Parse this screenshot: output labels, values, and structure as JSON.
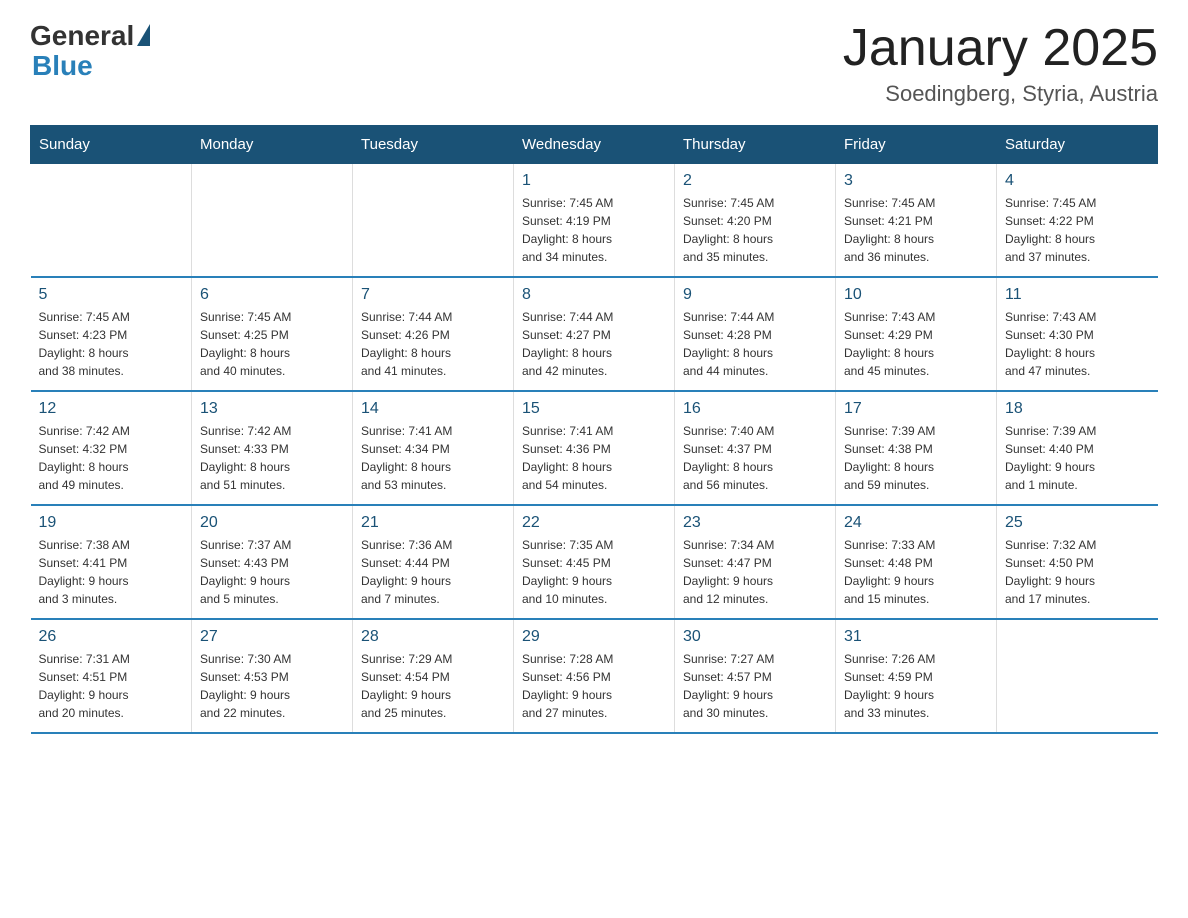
{
  "header": {
    "logo_general": "General",
    "logo_blue": "Blue",
    "title": "January 2025",
    "subtitle": "Soedingberg, Styria, Austria"
  },
  "weekdays": [
    "Sunday",
    "Monday",
    "Tuesday",
    "Wednesday",
    "Thursday",
    "Friday",
    "Saturday"
  ],
  "weeks": [
    [
      {
        "day": "",
        "info": ""
      },
      {
        "day": "",
        "info": ""
      },
      {
        "day": "",
        "info": ""
      },
      {
        "day": "1",
        "info": "Sunrise: 7:45 AM\nSunset: 4:19 PM\nDaylight: 8 hours\nand 34 minutes."
      },
      {
        "day": "2",
        "info": "Sunrise: 7:45 AM\nSunset: 4:20 PM\nDaylight: 8 hours\nand 35 minutes."
      },
      {
        "day": "3",
        "info": "Sunrise: 7:45 AM\nSunset: 4:21 PM\nDaylight: 8 hours\nand 36 minutes."
      },
      {
        "day": "4",
        "info": "Sunrise: 7:45 AM\nSunset: 4:22 PM\nDaylight: 8 hours\nand 37 minutes."
      }
    ],
    [
      {
        "day": "5",
        "info": "Sunrise: 7:45 AM\nSunset: 4:23 PM\nDaylight: 8 hours\nand 38 minutes."
      },
      {
        "day": "6",
        "info": "Sunrise: 7:45 AM\nSunset: 4:25 PM\nDaylight: 8 hours\nand 40 minutes."
      },
      {
        "day": "7",
        "info": "Sunrise: 7:44 AM\nSunset: 4:26 PM\nDaylight: 8 hours\nand 41 minutes."
      },
      {
        "day": "8",
        "info": "Sunrise: 7:44 AM\nSunset: 4:27 PM\nDaylight: 8 hours\nand 42 minutes."
      },
      {
        "day": "9",
        "info": "Sunrise: 7:44 AM\nSunset: 4:28 PM\nDaylight: 8 hours\nand 44 minutes."
      },
      {
        "day": "10",
        "info": "Sunrise: 7:43 AM\nSunset: 4:29 PM\nDaylight: 8 hours\nand 45 minutes."
      },
      {
        "day": "11",
        "info": "Sunrise: 7:43 AM\nSunset: 4:30 PM\nDaylight: 8 hours\nand 47 minutes."
      }
    ],
    [
      {
        "day": "12",
        "info": "Sunrise: 7:42 AM\nSunset: 4:32 PM\nDaylight: 8 hours\nand 49 minutes."
      },
      {
        "day": "13",
        "info": "Sunrise: 7:42 AM\nSunset: 4:33 PM\nDaylight: 8 hours\nand 51 minutes."
      },
      {
        "day": "14",
        "info": "Sunrise: 7:41 AM\nSunset: 4:34 PM\nDaylight: 8 hours\nand 53 minutes."
      },
      {
        "day": "15",
        "info": "Sunrise: 7:41 AM\nSunset: 4:36 PM\nDaylight: 8 hours\nand 54 minutes."
      },
      {
        "day": "16",
        "info": "Sunrise: 7:40 AM\nSunset: 4:37 PM\nDaylight: 8 hours\nand 56 minutes."
      },
      {
        "day": "17",
        "info": "Sunrise: 7:39 AM\nSunset: 4:38 PM\nDaylight: 8 hours\nand 59 minutes."
      },
      {
        "day": "18",
        "info": "Sunrise: 7:39 AM\nSunset: 4:40 PM\nDaylight: 9 hours\nand 1 minute."
      }
    ],
    [
      {
        "day": "19",
        "info": "Sunrise: 7:38 AM\nSunset: 4:41 PM\nDaylight: 9 hours\nand 3 minutes."
      },
      {
        "day": "20",
        "info": "Sunrise: 7:37 AM\nSunset: 4:43 PM\nDaylight: 9 hours\nand 5 minutes."
      },
      {
        "day": "21",
        "info": "Sunrise: 7:36 AM\nSunset: 4:44 PM\nDaylight: 9 hours\nand 7 minutes."
      },
      {
        "day": "22",
        "info": "Sunrise: 7:35 AM\nSunset: 4:45 PM\nDaylight: 9 hours\nand 10 minutes."
      },
      {
        "day": "23",
        "info": "Sunrise: 7:34 AM\nSunset: 4:47 PM\nDaylight: 9 hours\nand 12 minutes."
      },
      {
        "day": "24",
        "info": "Sunrise: 7:33 AM\nSunset: 4:48 PM\nDaylight: 9 hours\nand 15 minutes."
      },
      {
        "day": "25",
        "info": "Sunrise: 7:32 AM\nSunset: 4:50 PM\nDaylight: 9 hours\nand 17 minutes."
      }
    ],
    [
      {
        "day": "26",
        "info": "Sunrise: 7:31 AM\nSunset: 4:51 PM\nDaylight: 9 hours\nand 20 minutes."
      },
      {
        "day": "27",
        "info": "Sunrise: 7:30 AM\nSunset: 4:53 PM\nDaylight: 9 hours\nand 22 minutes."
      },
      {
        "day": "28",
        "info": "Sunrise: 7:29 AM\nSunset: 4:54 PM\nDaylight: 9 hours\nand 25 minutes."
      },
      {
        "day": "29",
        "info": "Sunrise: 7:28 AM\nSunset: 4:56 PM\nDaylight: 9 hours\nand 27 minutes."
      },
      {
        "day": "30",
        "info": "Sunrise: 7:27 AM\nSunset: 4:57 PM\nDaylight: 9 hours\nand 30 minutes."
      },
      {
        "day": "31",
        "info": "Sunrise: 7:26 AM\nSunset: 4:59 PM\nDaylight: 9 hours\nand 33 minutes."
      },
      {
        "day": "",
        "info": ""
      }
    ]
  ]
}
